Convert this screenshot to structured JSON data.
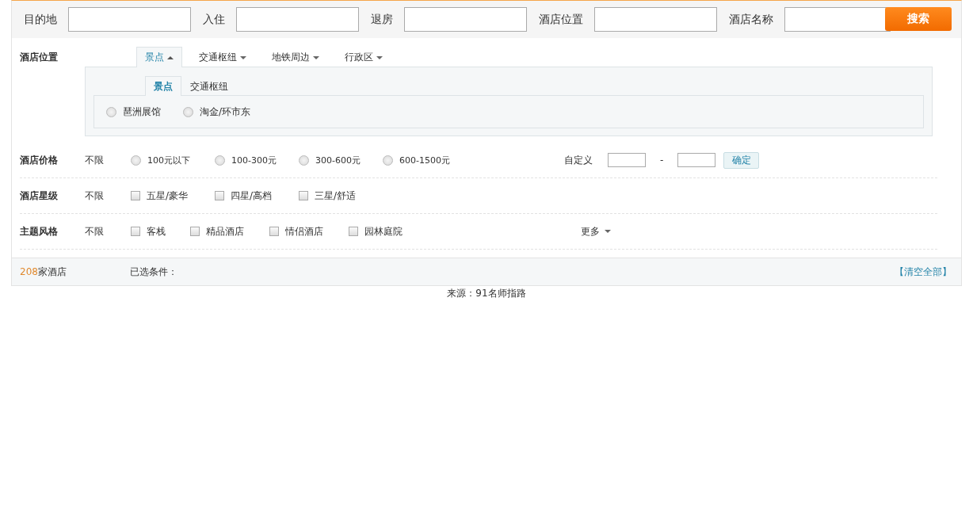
{
  "search": {
    "fields": [
      {
        "label": "目的地"
      },
      {
        "label": "入住"
      },
      {
        "label": "退房"
      },
      {
        "label": "酒店位置"
      },
      {
        "label": "酒店名称"
      }
    ],
    "button": "搜索"
  },
  "location": {
    "label": "酒店位置",
    "tabs": [
      {
        "label": "景点",
        "selected": true
      },
      {
        "label": "交通枢纽",
        "selected": false
      },
      {
        "label": "地铁周边",
        "selected": false
      },
      {
        "label": "行政区",
        "selected": false
      }
    ],
    "subtabs": [
      {
        "label": "景点",
        "selected": true
      },
      {
        "label": "交通枢纽",
        "selected": false
      }
    ],
    "options": [
      {
        "label": "琶洲展馆",
        "selected": false
      },
      {
        "label": "淘金/环市东",
        "selected": false
      }
    ]
  },
  "price": {
    "label": "酒店价格",
    "any": "不限",
    "options": [
      {
        "label": "100元以下",
        "selected": false
      },
      {
        "label": "100-300元",
        "selected": false
      },
      {
        "label": "300-600元",
        "selected": false
      },
      {
        "label": "600-1500元",
        "selected": false
      }
    ],
    "custom_label": "自定义",
    "separator": "-",
    "confirm": "确定"
  },
  "star": {
    "label": "酒店星级",
    "any": "不限",
    "options": [
      {
        "label": "五星/豪华",
        "checked": false
      },
      {
        "label": "四星/高档",
        "checked": false
      },
      {
        "label": "三星/舒适",
        "checked": false
      }
    ]
  },
  "theme": {
    "label": "主题风格",
    "any": "不限",
    "options": [
      {
        "label": "客栈",
        "checked": false
      },
      {
        "label": "精品酒店",
        "checked": false
      },
      {
        "label": "情侣酒店",
        "checked": false
      },
      {
        "label": "园林庭院",
        "checked": false
      }
    ],
    "more": "更多"
  },
  "summary": {
    "count": "208",
    "count_suffix": "家酒店",
    "selected_label": "已选条件：",
    "clear": "【清空全部】"
  },
  "source": "来源：91名师指路"
}
